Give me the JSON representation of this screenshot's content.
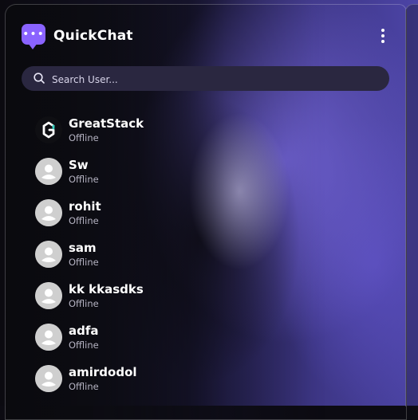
{
  "app": {
    "title": "QuickChat"
  },
  "search": {
    "placeholder": "Search User..."
  },
  "users": [
    {
      "name": "GreatStack",
      "status": "Offline"
    },
    {
      "name": "Sw",
      "status": "Offline"
    },
    {
      "name": "rohit",
      "status": "Offline"
    },
    {
      "name": "sam",
      "status": "Offline"
    },
    {
      "name": "kk kkasdks",
      "status": "Offline"
    },
    {
      "name": "adfa",
      "status": "Offline"
    },
    {
      "name": "amirdodol",
      "status": "Offline"
    }
  ],
  "colors": {
    "accent": "#8a63ff",
    "search_bg": "#2a2740",
    "status_text": "#b5b3c2"
  },
  "icons": {
    "logo": "chat-bubble-icon",
    "menu": "kebab-menu-icon",
    "search": "search-icon",
    "default_avatar": "user-avatar-icon",
    "brand_avatar": "greatstack-logo-icon"
  }
}
